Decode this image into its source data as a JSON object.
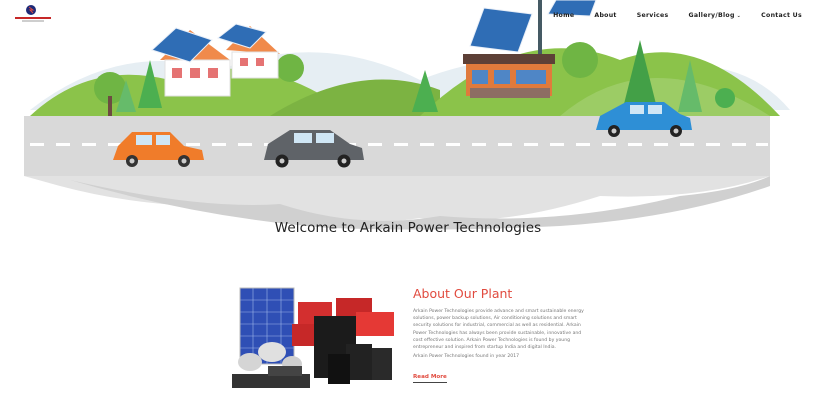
{
  "nav": {
    "logo_text": "Arkain Power Technologies",
    "items": [
      {
        "label": "Home"
      },
      {
        "label": "About"
      },
      {
        "label": "Services"
      },
      {
        "label": "Gallery/Blog",
        "has_dropdown": true
      },
      {
        "label": "Contact Us"
      }
    ]
  },
  "hero": {
    "heading": "Welcome to Arkain Power Technologies"
  },
  "about": {
    "title": "About Our Plant",
    "paragraph": "Arkain Power Technologies provide advance and smart sustainable energy solutions, power backup solutions, Air conditioning solutions and smart security solutions for industrial, commercial as well as residential. Arkain Power Technologies has always been provide sustainable, innovative and cost effective solution. Arkain Power Technologies is found by young entrepreneur and inspired from startup India and digital India.",
    "founded": "Arkain Power Technologies found in year 2017",
    "read_more": "Read More"
  },
  "colors": {
    "accent": "#e14b3f",
    "road": "#d9d9d9",
    "grass": "#8bc34a",
    "sky": "#dfe9ef"
  }
}
